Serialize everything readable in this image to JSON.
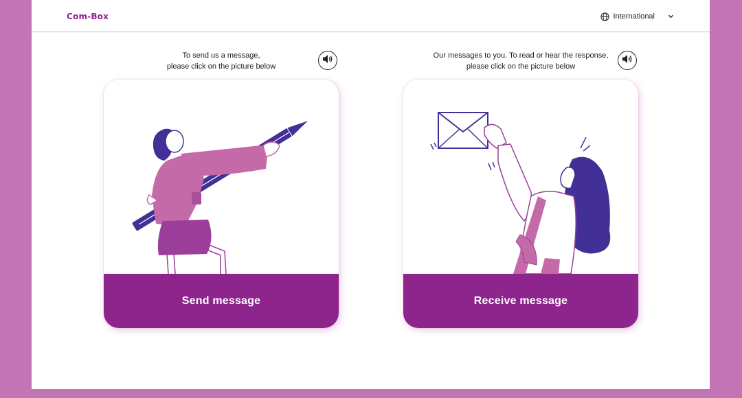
{
  "header": {
    "logo": "Com-Box",
    "language": "International",
    "globe_icon": "globe-icon",
    "chevron_icon": "chevron-down-icon"
  },
  "send": {
    "instruction_line1": "To send us a message,",
    "instruction_line2": "please click on the picture below",
    "audio_icon": "speaker-icon",
    "button_label": "Send message",
    "illustration": "person-with-pencil-illustration"
  },
  "receive": {
    "instruction_line1": "Our messages to you. To read or hear the response,",
    "instruction_line2": "please click on the picture below",
    "audio_icon": "speaker-icon",
    "button_label": "Receive message",
    "illustration": "person-with-envelope-illustration"
  },
  "colors": {
    "background": "#c274b4",
    "brand": "#8e258d",
    "accent_indigo": "#433097",
    "pink": "#c46aa8"
  }
}
